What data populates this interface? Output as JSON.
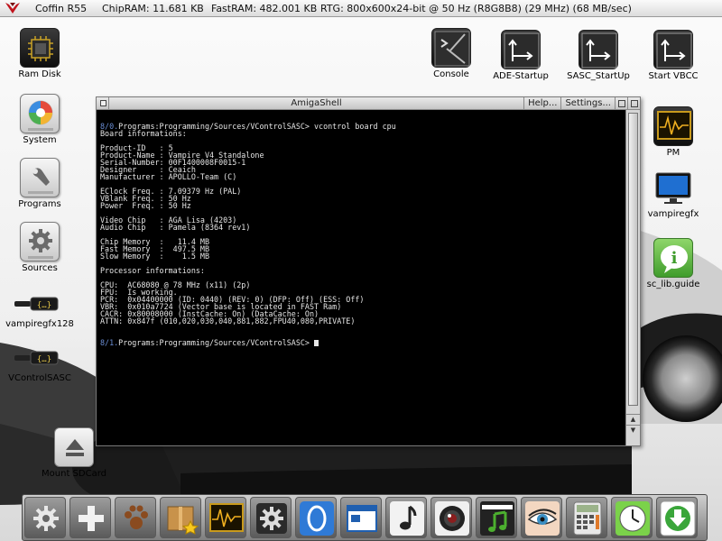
{
  "topbar": {
    "title": "Coffin R55",
    "chipram": "ChipRAM: 11.681 KB",
    "fastram": "FastRAM: 482.001 KB",
    "rtg": "RTG: 800x600x24-bit @ 50 Hz (R8G8B8) (29 MHz) (68 MB/sec)"
  },
  "desktop": {
    "left_icons": [
      {
        "label": "Ram Disk",
        "icon": "chip-icon"
      },
      {
        "label": "System",
        "icon": "disk-icon"
      },
      {
        "label": "Programs",
        "icon": "wrench-icon"
      },
      {
        "label": "Sources",
        "icon": "gear-icon"
      },
      {
        "label": "vampiregfx128",
        "icon": "cable-icon"
      },
      {
        "label": "VControlSASC",
        "icon": "cable-icon"
      },
      {
        "label": "Mount SDCard",
        "icon": "eject-icon"
      }
    ],
    "top_icons": [
      {
        "label": "Console",
        "icon": "console-icon"
      },
      {
        "label": "ADE-Startup",
        "icon": "script-icon"
      },
      {
        "label": "SASC_StartUp",
        "icon": "script-icon"
      },
      {
        "label": "Start VBCC",
        "icon": "script-icon"
      }
    ],
    "right_icons": [
      {
        "label": "PM",
        "icon": "monitor-wave-icon"
      },
      {
        "label": "vampiregfx",
        "icon": "screen-icon"
      },
      {
        "label": "sc_lib.guide",
        "icon": "help-bubble-icon"
      }
    ]
  },
  "shell": {
    "title": "AmigaShell",
    "help_label": "Help...",
    "settings_label": "Settings...",
    "lines": [
      {
        "num": "8/0.",
        "text": "Programs:Programming/Sources/VControlSASC> vcontrol board cpu"
      },
      {
        "text": "Board informations:"
      },
      {
        "text": ""
      },
      {
        "text": "Product-ID   : 5"
      },
      {
        "text": "Product-Name : Vampire V4 Standalone"
      },
      {
        "text": "Serial-Number: 00F1400008F0015-1"
      },
      {
        "text": "Designer     : Ceaich"
      },
      {
        "text": "Manufacturer : APOLLO-Team (C)"
      },
      {
        "text": ""
      },
      {
        "text": "EClock Freq. : 7.09379 Hz (PAL)"
      },
      {
        "text": "VBlank Freq. : 50 Hz"
      },
      {
        "text": "Power  Freq. : 50 Hz"
      },
      {
        "text": ""
      },
      {
        "text": "Video Chip   : AGA Lisa (4203)"
      },
      {
        "text": "Audio Chip   : Pamela (8364 rev1)"
      },
      {
        "text": ""
      },
      {
        "text": "Chip Memory  :   11.4 MB"
      },
      {
        "text": "Fast Memory  :  497.5 MB"
      },
      {
        "text": "Slow Memory  :    1.5 MB"
      },
      {
        "text": ""
      },
      {
        "text": "Processor informations:"
      },
      {
        "text": ""
      },
      {
        "text": "CPU:  AC68080 @ 78 MHz (x11) (2p)"
      },
      {
        "text": "FPU:  Is working."
      },
      {
        "text": "PCR:  0x04400000 (ID: 0440) (REV: 0) (DFP: Off) (ESS: Off)"
      },
      {
        "text": "VBR:  0x010a7724 (Vector base is located in FAST Ram)"
      },
      {
        "text": "CACR: 0x80008000 (InstCache: On) (DataCache: On)"
      },
      {
        "text": "ATTN: 0x847f (010,020,030,040,881,882,FPU40,080,PRIVATE)"
      },
      {
        "text": ""
      },
      {
        "text": ""
      },
      {
        "num": "8/1.",
        "text": "Programs:Programming/Sources/VControlSASC> ",
        "cursor": true
      }
    ]
  },
  "dock": {
    "items": [
      {
        "icon": "gear-icon"
      },
      {
        "icon": "plus-icon"
      },
      {
        "icon": "paw-icon"
      },
      {
        "icon": "box-star-icon"
      },
      {
        "icon": "monitor-wave-icon"
      },
      {
        "icon": "gear-box-icon"
      },
      {
        "icon": "info-circle-icon"
      },
      {
        "icon": "window-icon"
      },
      {
        "icon": "music-note-icon"
      },
      {
        "icon": "camera-lens-icon"
      },
      {
        "icon": "film-music-icon"
      },
      {
        "icon": "eye-icon"
      },
      {
        "icon": "calculator-icon"
      },
      {
        "icon": "clock-icon"
      },
      {
        "icon": "download-icon"
      }
    ]
  },
  "colors": {
    "shell_bg": "#000000",
    "shell_text": "#e6e6e6",
    "prompt_num": "#6b8fd6"
  }
}
